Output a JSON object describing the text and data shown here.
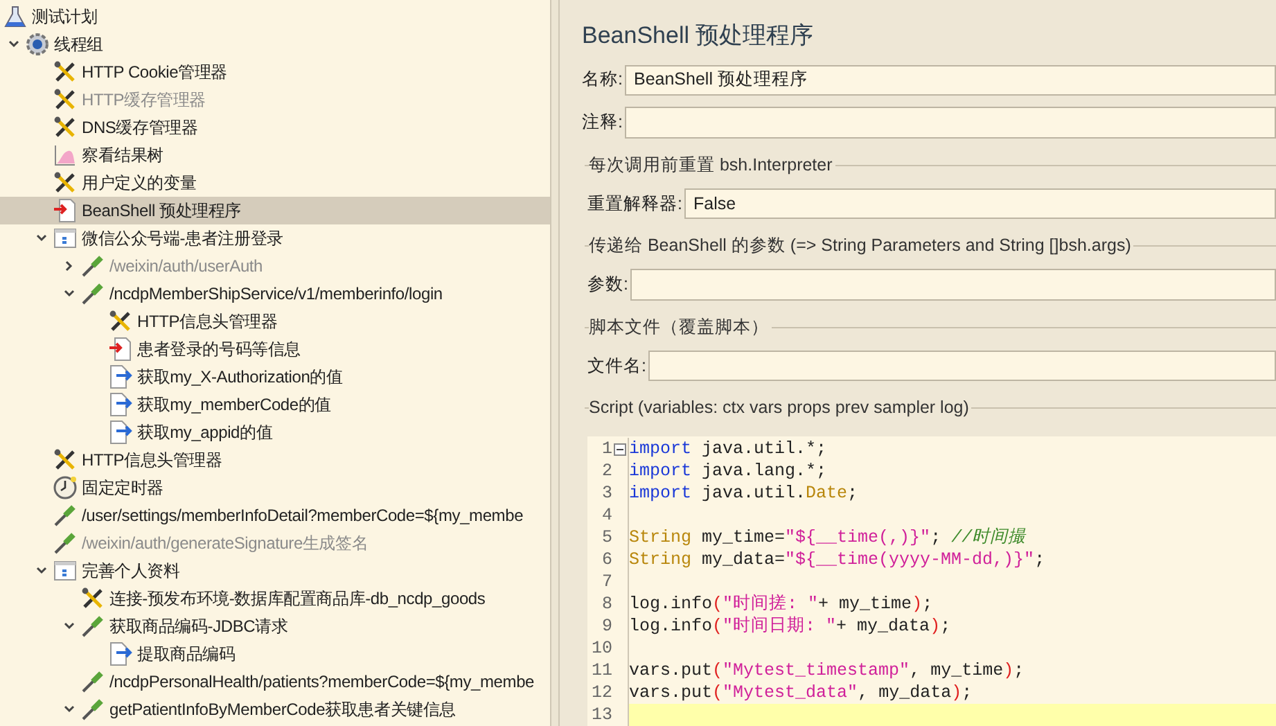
{
  "tree": [
    {
      "label": "测试计划",
      "kind": "plan",
      "disabled": false,
      "selected": false,
      "children": [
        {
          "label": "线程组",
          "kind": "threads",
          "disabled": false,
          "selected": false,
          "expanded": true,
          "children": [
            {
              "label": "HTTP Cookie管理器",
              "kind": "config",
              "disabled": false,
              "selected": false
            },
            {
              "label": "HTTP缓存管理器",
              "kind": "config",
              "disabled": true,
              "selected": false
            },
            {
              "label": "DNS缓存管理器",
              "kind": "config",
              "disabled": false,
              "selected": false
            },
            {
              "label": "察看结果树",
              "kind": "listener",
              "disabled": false,
              "selected": false
            },
            {
              "label": "用户定义的变量",
              "kind": "config",
              "disabled": false,
              "selected": false
            },
            {
              "label": "BeanShell 预处理程序",
              "kind": "preprocessor",
              "disabled": false,
              "selected": true
            },
            {
              "label": "微信公众号端-患者注册登录",
              "kind": "controller",
              "disabled": false,
              "selected": false,
              "expanded": true,
              "children": [
                {
                  "label": "/weixin/auth/userAuth",
                  "kind": "sampler",
                  "disabled": true,
                  "selected": false,
                  "expanded": false
                },
                {
                  "label": "/ncdpMemberShipService/v1/memberinfo/login",
                  "kind": "sampler",
                  "disabled": false,
                  "selected": false,
                  "expanded": true,
                  "children": [
                    {
                      "label": "HTTP信息头管理器",
                      "kind": "config",
                      "disabled": false,
                      "selected": false
                    },
                    {
                      "label": "患者登录的号码等信息",
                      "kind": "preprocessor",
                      "disabled": false,
                      "selected": false
                    },
                    {
                      "label": "获取my_X-Authorization的值",
                      "kind": "postprocessor",
                      "disabled": false,
                      "selected": false
                    },
                    {
                      "label": "获取my_memberCode的值",
                      "kind": "postprocessor",
                      "disabled": false,
                      "selected": false
                    },
                    {
                      "label": "获取my_appid的值",
                      "kind": "postprocessor",
                      "disabled": false,
                      "selected": false
                    }
                  ]
                }
              ]
            },
            {
              "label": "HTTP信息头管理器",
              "kind": "config",
              "disabled": false,
              "selected": false
            },
            {
              "label": "固定定时器",
              "kind": "timer",
              "disabled": false,
              "selected": false
            },
            {
              "label": "/user/settings/memberInfoDetail?memberCode=${my_membe",
              "kind": "sampler",
              "disabled": false,
              "selected": false
            },
            {
              "label": "/weixin/auth/generateSignature生成签名",
              "kind": "sampler",
              "disabled": true,
              "selected": false
            },
            {
              "label": "完善个人资料",
              "kind": "controller",
              "disabled": false,
              "selected": false,
              "expanded": true,
              "children": [
                {
                  "label": "连接-预发布环境-数据库配置商品库-db_ncdp_goods",
                  "kind": "config",
                  "disabled": false,
                  "selected": false
                },
                {
                  "label": "获取商品编码-JDBC请求",
                  "kind": "sampler",
                  "disabled": false,
                  "selected": false,
                  "expanded": true,
                  "children": [
                    {
                      "label": "提取商品编码",
                      "kind": "postprocessor",
                      "disabled": false,
                      "selected": false
                    }
                  ]
                },
                {
                  "label": "/ncdpPersonalHealth/patients?memberCode=${my_membe",
                  "kind": "sampler",
                  "disabled": false,
                  "selected": false
                },
                {
                  "label": "getPatientInfoByMemberCode获取患者关键信息",
                  "kind": "sampler",
                  "disabled": false,
                  "selected": false,
                  "expanded": true
                }
              ]
            }
          ]
        }
      ]
    }
  ],
  "panel": {
    "title": "BeanShell 预处理程序",
    "name_field": {
      "label": "名称:",
      "value": "BeanShell 预处理程序"
    },
    "comment_field": {
      "label": "注释:"
    },
    "reset_section": {
      "title": "每次调用前重置 bsh.Interpreter",
      "label": "重置解释器:",
      "value": "False"
    },
    "params_section": {
      "title": "传递给 BeanShell 的参数 (=> String Parameters and String []bsh.args)",
      "label": "参数:"
    },
    "file_section": {
      "title": "脚本文件（覆盖脚本）",
      "label": "文件名:"
    },
    "script_section": {
      "title": "Script (variables: ctx vars props prev sampler log)",
      "lines": [
        {
          "number": "1",
          "current": false,
          "tokens": [
            {
              "kind": "keyword",
              "text": "import"
            },
            {
              "kind": "plain",
              "text": " java.util.*;"
            }
          ]
        },
        {
          "number": "2",
          "current": false,
          "tokens": [
            {
              "kind": "keyword",
              "text": "import"
            },
            {
              "kind": "plain",
              "text": " java.lang.*;"
            }
          ]
        },
        {
          "number": "3",
          "current": false,
          "tokens": [
            {
              "kind": "keyword",
              "text": "import"
            },
            {
              "kind": "plain",
              "text": " java.util."
            },
            {
              "kind": "type",
              "text": "Date"
            },
            {
              "kind": "plain",
              "text": ";"
            }
          ]
        },
        {
          "number": "4",
          "current": false
        },
        {
          "number": "5",
          "current": false,
          "tokens": [
            {
              "kind": "type",
              "text": "String"
            },
            {
              "kind": "plain",
              "text": " my_time="
            },
            {
              "kind": "string",
              "text": "\"${__time(,)}\""
            },
            {
              "kind": "plain",
              "text": "; "
            },
            {
              "kind": "comment",
              "text": "//时间撮"
            }
          ]
        },
        {
          "number": "6",
          "current": false,
          "tokens": [
            {
              "kind": "type",
              "text": "String"
            },
            {
              "kind": "plain",
              "text": " my_data="
            },
            {
              "kind": "string",
              "text": "\"${__time(yyyy-MM-dd,)}\""
            },
            {
              "kind": "plain",
              "text": ";"
            }
          ]
        },
        {
          "number": "7",
          "current": false
        },
        {
          "number": "8",
          "current": false,
          "tokens": [
            {
              "kind": "plain",
              "text": "log.info"
            },
            {
              "kind": "paren",
              "text": "("
            },
            {
              "kind": "string",
              "text": "\"时间搓: \""
            },
            {
              "kind": "plain",
              "text": "+ my_time"
            },
            {
              "kind": "paren",
              "text": ")"
            },
            {
              "kind": "plain",
              "text": ";"
            }
          ]
        },
        {
          "number": "9",
          "current": false,
          "tokens": [
            {
              "kind": "plain",
              "text": "log.info"
            },
            {
              "kind": "paren",
              "text": "("
            },
            {
              "kind": "string",
              "text": "\"时间日期: \""
            },
            {
              "kind": "plain",
              "text": "+ my_data"
            },
            {
              "kind": "paren",
              "text": ")"
            },
            {
              "kind": "plain",
              "text": ";"
            }
          ]
        },
        {
          "number": "10",
          "current": false
        },
        {
          "number": "11",
          "current": false,
          "tokens": [
            {
              "kind": "plain",
              "text": "vars.put"
            },
            {
              "kind": "paren",
              "text": "("
            },
            {
              "kind": "string",
              "text": "\"Mytest_timestamp\""
            },
            {
              "kind": "plain",
              "text": ", my_time"
            },
            {
              "kind": "paren",
              "text": ")"
            },
            {
              "kind": "plain",
              "text": ";"
            }
          ]
        },
        {
          "number": "12",
          "current": false,
          "tokens": [
            {
              "kind": "plain",
              "text": "vars.put"
            },
            {
              "kind": "paren",
              "text": "("
            },
            {
              "kind": "string",
              "text": "\"Mytest_data\""
            },
            {
              "kind": "plain",
              "text": ", my_data"
            },
            {
              "kind": "paren",
              "text": ")"
            },
            {
              "kind": "plain",
              "text": ";"
            }
          ]
        },
        {
          "number": "13",
          "current": true
        }
      ]
    }
  }
}
